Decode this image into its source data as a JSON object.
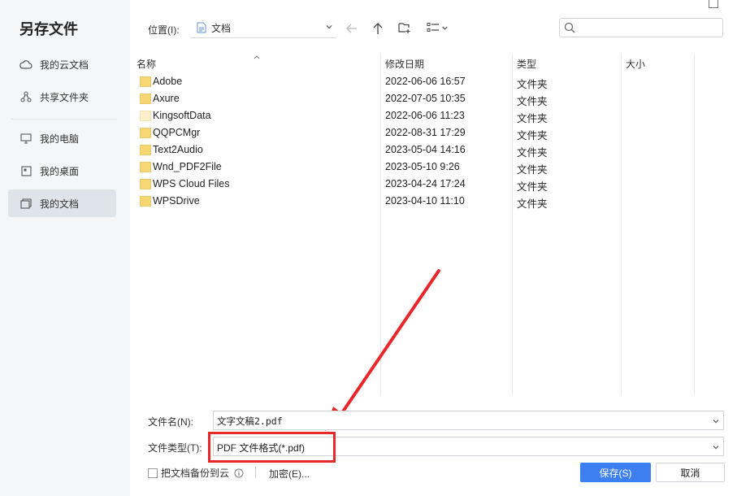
{
  "dialog": {
    "title": "另存文件"
  },
  "sidebar": {
    "items": [
      {
        "label": "我的云文档",
        "icon": "cloud-icon"
      },
      {
        "label": "共享文件夹",
        "icon": "share-icon"
      },
      {
        "label": "我的电脑",
        "icon": "monitor-icon"
      },
      {
        "label": "我的桌面",
        "icon": "desktop-icon"
      },
      {
        "label": "我的文档",
        "icon": "documents-icon",
        "active": true
      }
    ]
  },
  "toolbar": {
    "location_label": "位置(I):",
    "location_value": "文档",
    "search_placeholder": ""
  },
  "columns": {
    "name": "名称",
    "date": "修改日期",
    "type": "类型",
    "size": "大小"
  },
  "files": [
    {
      "name": "Adobe",
      "date": "2022-06-06 16:57",
      "type": "文件夹"
    },
    {
      "name": "Axure",
      "date": "2022-07-05 10:35",
      "type": "文件夹"
    },
    {
      "name": "KingsoftData",
      "date": "2022-06-06 11:23",
      "type": "文件夹"
    },
    {
      "name": "QQPCMgr",
      "date": "2022-08-31 17:29",
      "type": "文件夹"
    },
    {
      "name": "Text2Audio",
      "date": "2023-05-04 14:16",
      "type": "文件夹"
    },
    {
      "name": "Wnd_PDF2File",
      "date": "2023-05-10 9:26",
      "type": "文件夹"
    },
    {
      "name": "WPS Cloud Files",
      "date": "2023-04-24 17:24",
      "type": "文件夹"
    },
    {
      "name": "WPSDrive",
      "date": "2023-04-10 11:10",
      "type": "文件夹"
    }
  ],
  "form": {
    "filename_label": "文件名(N):",
    "filename_value": "文字文稿2.pdf",
    "filetype_label": "文件类型(T):",
    "filetype_value": "PDF 文件格式(*.pdf)",
    "backup_label": "把文档备份到云",
    "encrypt_label": "加密(E)...",
    "save_label": "保存(S)",
    "cancel_label": "取消"
  },
  "colors": {
    "accent": "#3d7ef0",
    "highlight": "#e8272a",
    "folder": "#f7d774"
  }
}
